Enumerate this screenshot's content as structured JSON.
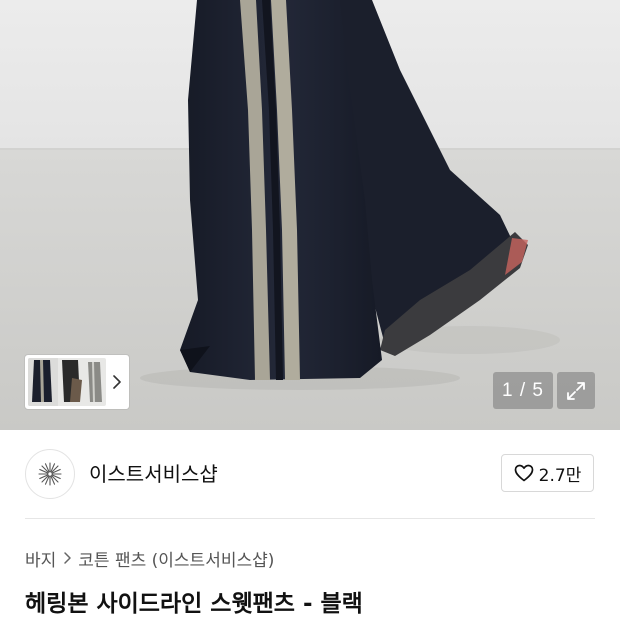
{
  "gallery": {
    "counter_text": "1 / 5",
    "expand_icon": "expand-icon",
    "thumbnail_icon": "chevron-right-icon"
  },
  "store": {
    "name": "이스트서비스샵",
    "logo_icon": "starburst-logo",
    "like_count": "2.7만",
    "like_icon": "heart-outline-icon"
  },
  "breadcrumb": {
    "items": [
      "바지",
      "코튼 팬츠 (이스트서비스샵)"
    ],
    "separator_icon": "chevron-right-icon"
  },
  "product": {
    "title": "헤링본 사이드라인 스웻팬츠 - 블랙"
  },
  "colors": {
    "pants": "#1d2130",
    "stripe": "#a9a597",
    "floor": "#cfcfcc",
    "wall": "#e9e9e9",
    "overlay": "rgba(120,120,120,0.55)"
  }
}
